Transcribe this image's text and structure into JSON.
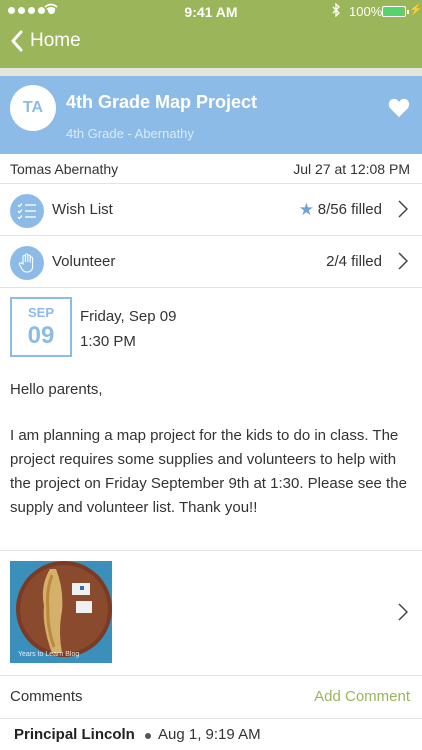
{
  "status_bar": {
    "time": "9:41 AM",
    "battery": "100%"
  },
  "nav": {
    "back_label": "Home"
  },
  "header": {
    "initials": "TA",
    "title": "4th Grade Map Project",
    "subtitle": "4th Grade - Abernathy"
  },
  "post": {
    "author": "Tomas Abernathy",
    "posted_at": "Jul 27 at 12:08 PM",
    "wish_list": {
      "label": "Wish List",
      "count": "8/56 filled"
    },
    "volunteer": {
      "label": "Volunteer",
      "count": "2/4 filled"
    },
    "event": {
      "month": "SEP",
      "day": "09",
      "date": "Friday, Sep 09",
      "time": "1:30 PM"
    },
    "greeting": "Hello parents,",
    "message": "I am planning a map project for the kids to do in class. The project requires some supplies and volunteers to help with the project on Friday September 9th at 1:30. Please see the supply and volunteer list. Thank you!!",
    "photo_watermark": "Years to Learn Blog"
  },
  "comments": {
    "label": "Comments",
    "add_label": "Add Comment",
    "first": {
      "author": "Principal Lincoln",
      "time": "Aug 1, 9:19 AM"
    }
  },
  "colors": {
    "nav": "#9bb55a",
    "header": "#8dbbe7",
    "accent": "#6fa3da"
  }
}
